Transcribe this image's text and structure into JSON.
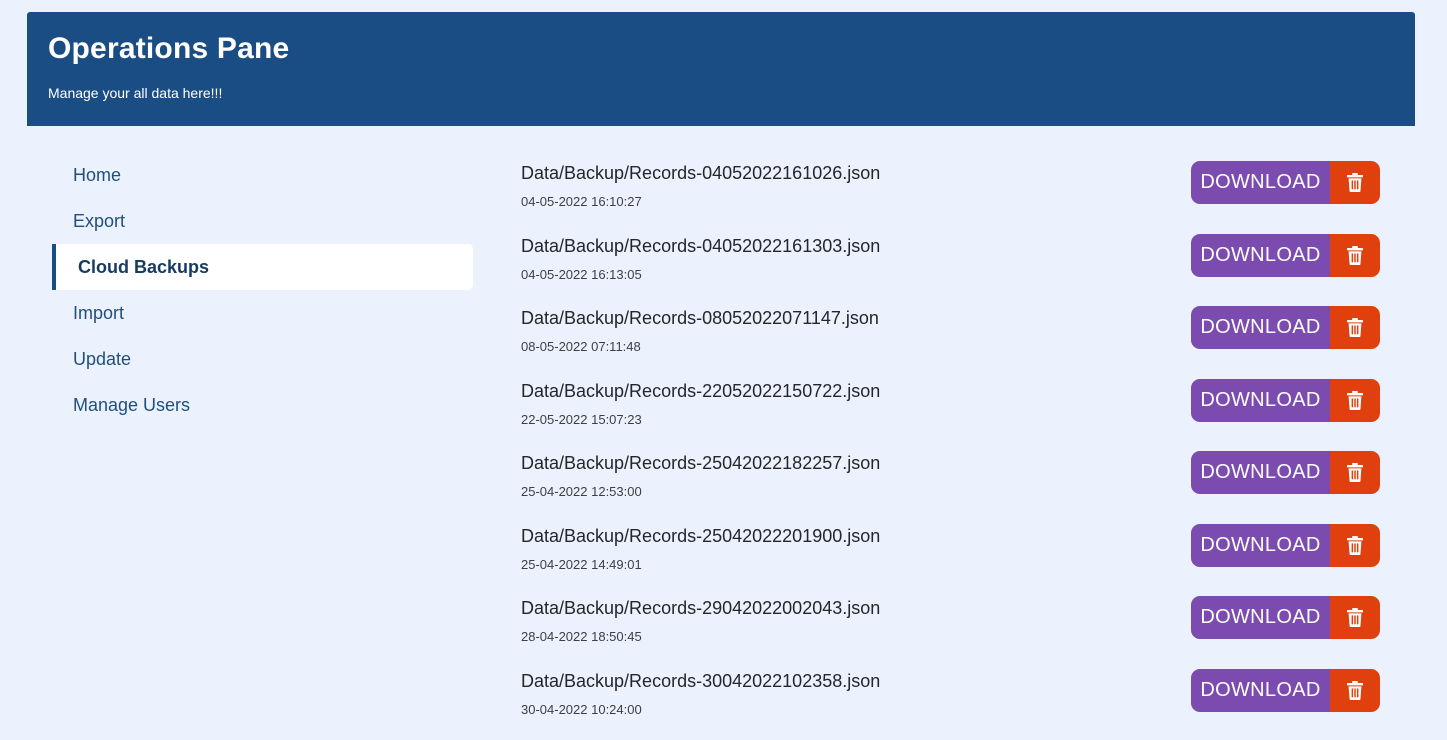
{
  "header": {
    "title": "Operations Pane",
    "subtitle": "Manage your all data here!!!"
  },
  "colors": {
    "header_bg": "#1b4d85",
    "page_bg": "#ebf2fd",
    "download_button": "#7b4bb0",
    "delete_button": "#e0400e"
  },
  "sidebar": {
    "items": [
      {
        "label": "Home",
        "active": false
      },
      {
        "label": "Export",
        "active": false
      },
      {
        "label": "Cloud Backups",
        "active": true
      },
      {
        "label": "Import",
        "active": false
      },
      {
        "label": "Update",
        "active": false
      },
      {
        "label": "Manage Users",
        "active": false
      }
    ]
  },
  "backups": {
    "download_label": "DOWNLOAD",
    "delete_icon": "trash-icon",
    "files": [
      {
        "name": "Data/Backup/Records-04052022161026.json",
        "date": "04-05-2022 16:10:27"
      },
      {
        "name": "Data/Backup/Records-04052022161303.json",
        "date": "04-05-2022 16:13:05"
      },
      {
        "name": "Data/Backup/Records-08052022071147.json",
        "date": "08-05-2022 07:11:48"
      },
      {
        "name": "Data/Backup/Records-22052022150722.json",
        "date": "22-05-2022 15:07:23"
      },
      {
        "name": "Data/Backup/Records-25042022182257.json",
        "date": "25-04-2022 12:53:00"
      },
      {
        "name": "Data/Backup/Records-25042022201900.json",
        "date": "25-04-2022 14:49:01"
      },
      {
        "name": "Data/Backup/Records-29042022002043.json",
        "date": "28-04-2022 18:50:45"
      },
      {
        "name": "Data/Backup/Records-30042022102358.json",
        "date": "30-04-2022 10:24:00"
      }
    ]
  }
}
